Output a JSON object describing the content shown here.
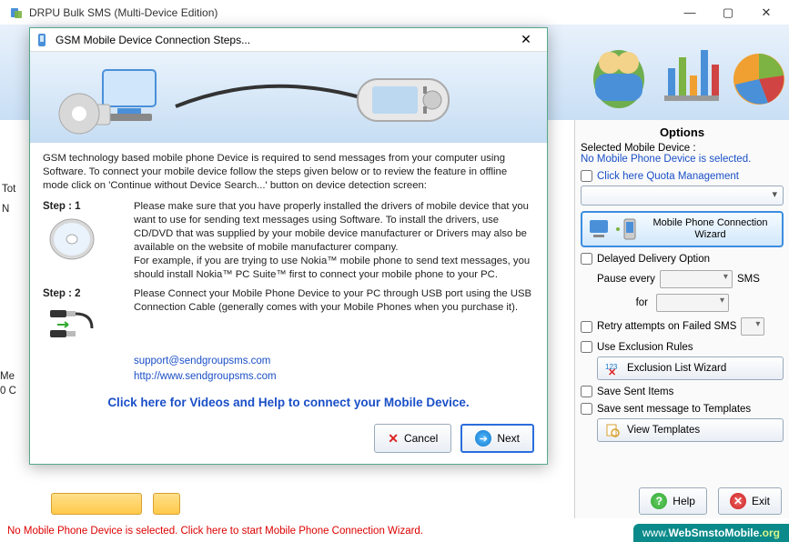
{
  "window": {
    "title": "DRPU Bulk SMS (Multi-Device Edition)"
  },
  "options": {
    "heading": "Options",
    "selected_label": "Selected Mobile Device :",
    "selected_value": "No Mobile Phone Device is selected.",
    "quota_label": "Click here Quota Management",
    "wizard_label": "Mobile Phone Connection  Wizard",
    "delayed_label": "Delayed Delivery Option",
    "pause_label": "Pause every",
    "sms_suffix": "SMS",
    "for_label": "for",
    "retry_label": "Retry attempts on Failed SMS",
    "exclusion_label": "Use Exclusion Rules",
    "exclusion_btn": "Exclusion List Wizard",
    "save_sent_label": "Save Sent Items",
    "save_tmpl_label": "Save sent message to Templates",
    "view_tmpl_btn": "View Templates"
  },
  "bottom": {
    "help": "Help",
    "exit": "Exit",
    "status": "No Mobile Phone Device is selected. Click here to start Mobile Phone Connection Wizard.",
    "website_www": "www.",
    "website_dom": "WebSmstoMobile",
    "website_org": ".org"
  },
  "left": {
    "tot_label": "Tot",
    "n_label": "N",
    "me_label": "Me",
    "zero_label": "0 C"
  },
  "modal": {
    "title": "GSM Mobile Device Connection Steps...",
    "intro": "GSM technology based mobile phone Device is required to send messages from your computer using Software.  To connect your mobile device follow the steps given below or to review the feature in offline mode click on 'Continue without Device Search...' button on device detection screen:",
    "step1_head": "Step : 1",
    "step1_text": "Please make sure that you have properly installed the drivers of mobile device that you want to use for sending text messages using Software. To install the drivers, use CD/DVD that was supplied by your mobile device manufacturer or Drivers may also be available on the website of mobile manufacturer company.\nFor example, if you are trying to use Nokia™ mobile phone to send text messages, you should install Nokia™ PC Suite™ first to connect your mobile phone to your PC.",
    "step2_head": "Step : 2",
    "step2_text": "Please Connect your Mobile Phone Device to your PC through USB port using the USB Connection Cable (generally comes with your Mobile Phones when you purchase it).",
    "link1": "support@sendgroupsms.com",
    "link2": "http://www.sendgroupsms.com",
    "video_link": "Click here for Videos and Help to connect your Mobile Device.",
    "cancel": "Cancel",
    "next": "Next"
  }
}
